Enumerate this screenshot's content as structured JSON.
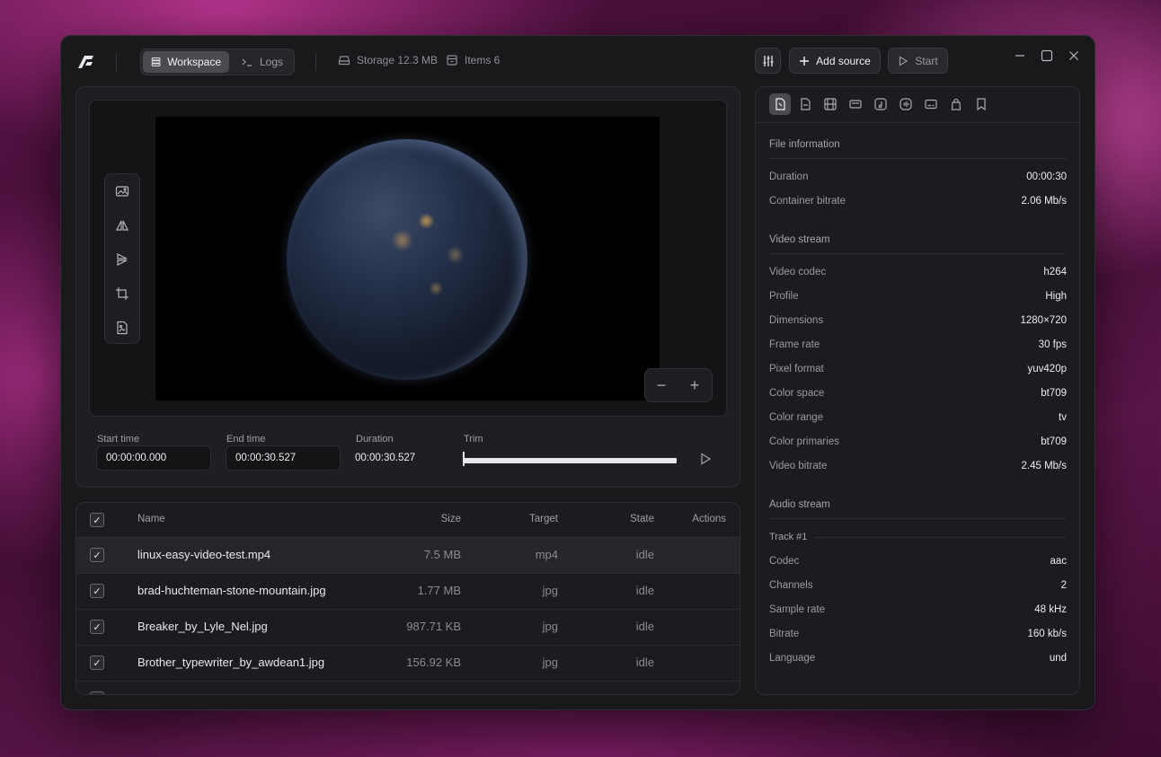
{
  "header": {
    "tabs": [
      {
        "label": "Workspace",
        "icon": "layers-icon",
        "active": true
      },
      {
        "label": "Logs",
        "icon": "terminal-icon",
        "active": false
      }
    ],
    "storage": "Storage 12.3 MB",
    "items": "Items 6",
    "add_source": "Add source",
    "start": "Start"
  },
  "editor": {
    "start_label": "Start time",
    "start_value": "00:00:00.000",
    "end_label": "End time",
    "end_value": "00:00:30.527",
    "duration_label": "Duration",
    "duration_value": "00:00:30.527",
    "trim_label": "Trim",
    "zoom_out": "−",
    "zoom_in": "+"
  },
  "table": {
    "columns": [
      "Name",
      "Size",
      "Target",
      "State",
      "Actions"
    ],
    "rows": [
      {
        "name": "linux-easy-video-test.mp4",
        "size": "7.5 MB",
        "target": "mp4",
        "state": "idle"
      },
      {
        "name": "brad-huchteman-stone-mountain.jpg",
        "size": "1.77 MB",
        "target": "jpg",
        "state": "idle"
      },
      {
        "name": "Breaker_by_Lyle_Nel.jpg",
        "size": "987.71 KB",
        "target": "jpg",
        "state": "idle"
      },
      {
        "name": "Brother_typewriter_by_awdean1.jpg",
        "size": "156.92 KB",
        "target": "jpg",
        "state": "idle"
      }
    ]
  },
  "info": {
    "file_title": "File information",
    "file": [
      {
        "k": "Duration",
        "v": "00:00:30"
      },
      {
        "k": "Container bitrate",
        "v": "2.06 Mb/s"
      }
    ],
    "video_title": "Video stream",
    "video": [
      {
        "k": "Video codec",
        "v": "h264"
      },
      {
        "k": "Profile",
        "v": "High"
      },
      {
        "k": "Dimensions",
        "v": "1280×720"
      },
      {
        "k": "Frame rate",
        "v": "30 fps"
      },
      {
        "k": "Pixel format",
        "v": "yuv420p"
      },
      {
        "k": "Color space",
        "v": "bt709"
      },
      {
        "k": "Color range",
        "v": "tv"
      },
      {
        "k": "Color primaries",
        "v": "bt709"
      },
      {
        "k": "Video bitrate",
        "v": "2.45 Mb/s"
      }
    ],
    "audio_title": "Audio stream",
    "track_title": "Track #1",
    "audio": [
      {
        "k": "Codec",
        "v": "aac"
      },
      {
        "k": "Channels",
        "v": "2"
      },
      {
        "k": "Sample rate",
        "v": "48 kHz"
      },
      {
        "k": "Bitrate",
        "v": "160 kb/s"
      },
      {
        "k": "Language",
        "v": "und"
      }
    ]
  },
  "colors": {
    "accent_active": "#4a4a50",
    "panel": "#1c1c20",
    "window": "#19191c"
  }
}
